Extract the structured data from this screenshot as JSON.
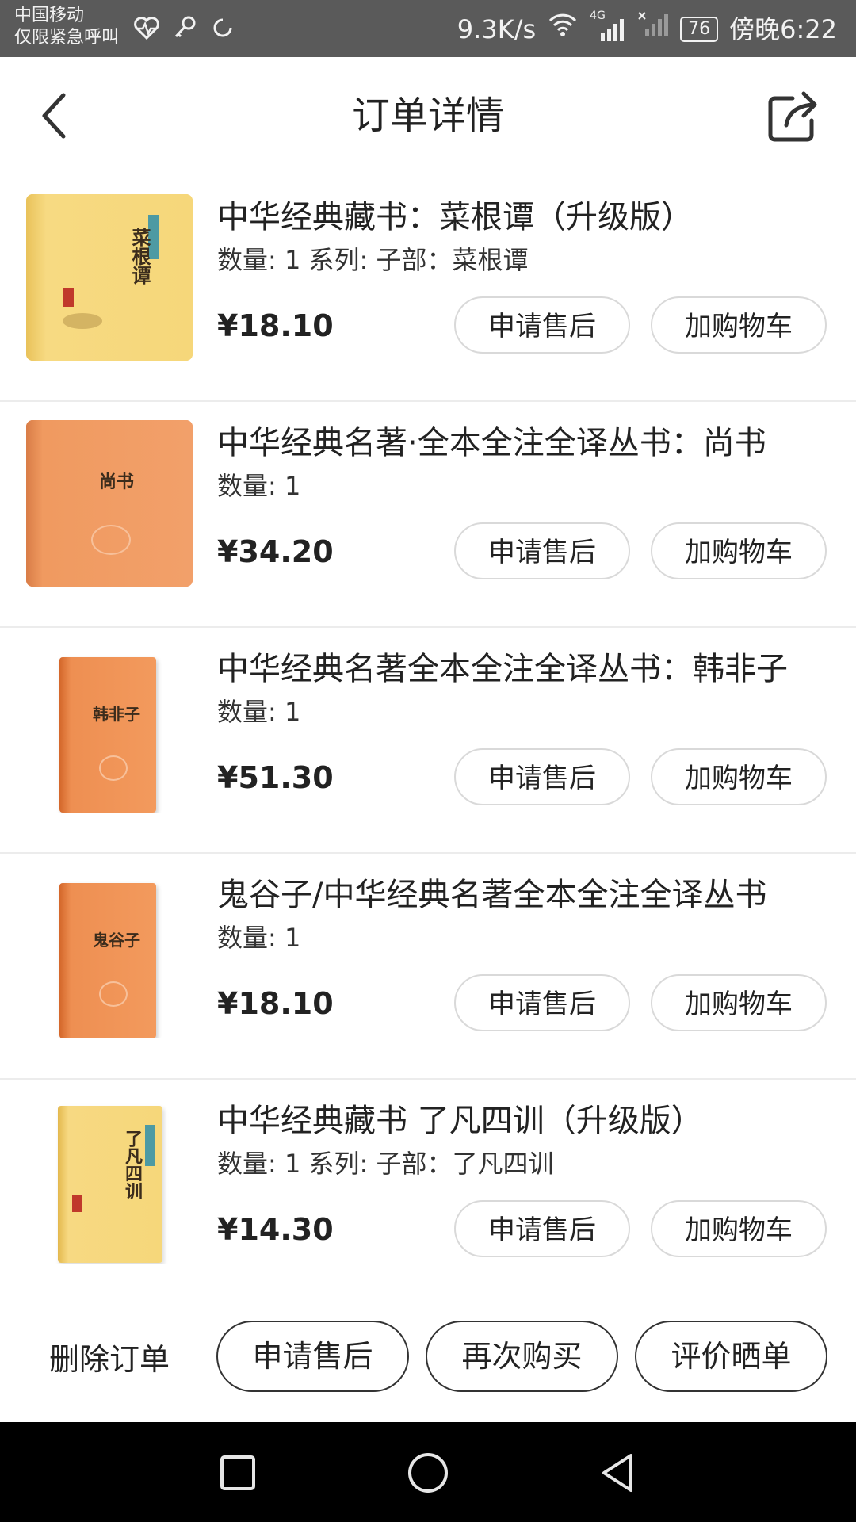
{
  "status_bar": {
    "carrier": "中国移动",
    "carrier_note": "仅限紧急呼叫",
    "net_speed": "9.3K/s",
    "network": "4G",
    "battery": "76",
    "time": "傍晚6:22"
  },
  "header": {
    "title": "订单详情"
  },
  "items": [
    {
      "title": "中华经典藏书：菜根谭（升级版）",
      "meta": "数量: 1 系列: 子部：菜根谭",
      "price": "¥18.10",
      "after_sale_label": "申请售后",
      "cart_label": "加购物车",
      "cover_title": "菜根谭"
    },
    {
      "title": "中华经典名著·全本全注全译丛书：尚书",
      "meta": "数量: 1",
      "price": "¥34.20",
      "after_sale_label": "申请售后",
      "cart_label": "加购物车",
      "cover_title": "尚书"
    },
    {
      "title": "中华经典名著全本全注全译丛书：韩非子",
      "meta": "数量: 1",
      "price": "¥51.30",
      "after_sale_label": "申请售后",
      "cart_label": "加购物车",
      "cover_title": "韩非子"
    },
    {
      "title": "鬼谷子/中华经典名著全本全注全译丛书",
      "meta": "数量: 1",
      "price": "¥18.10",
      "after_sale_label": "申请售后",
      "cart_label": "加购物车",
      "cover_title": "鬼谷子"
    },
    {
      "title": "中华经典藏书 了凡四训（升级版）",
      "meta": "数量: 1 系列: 子部：了凡四训",
      "price": "¥14.30",
      "after_sale_label": "申请售后",
      "cart_label": "加购物车",
      "cover_title": "了凡四训"
    }
  ],
  "action_bar": {
    "delete_label": "删除订单",
    "after_sale_label": "申请售后",
    "rebuy_label": "再次购买",
    "review_label": "评价晒单"
  },
  "colors": {
    "status_bg": "#5a5a5a",
    "yellow_cover": "#f6d77a",
    "orange_cover": "#f0955a",
    "divider": "#ececec",
    "nav_bg": "#000000"
  }
}
